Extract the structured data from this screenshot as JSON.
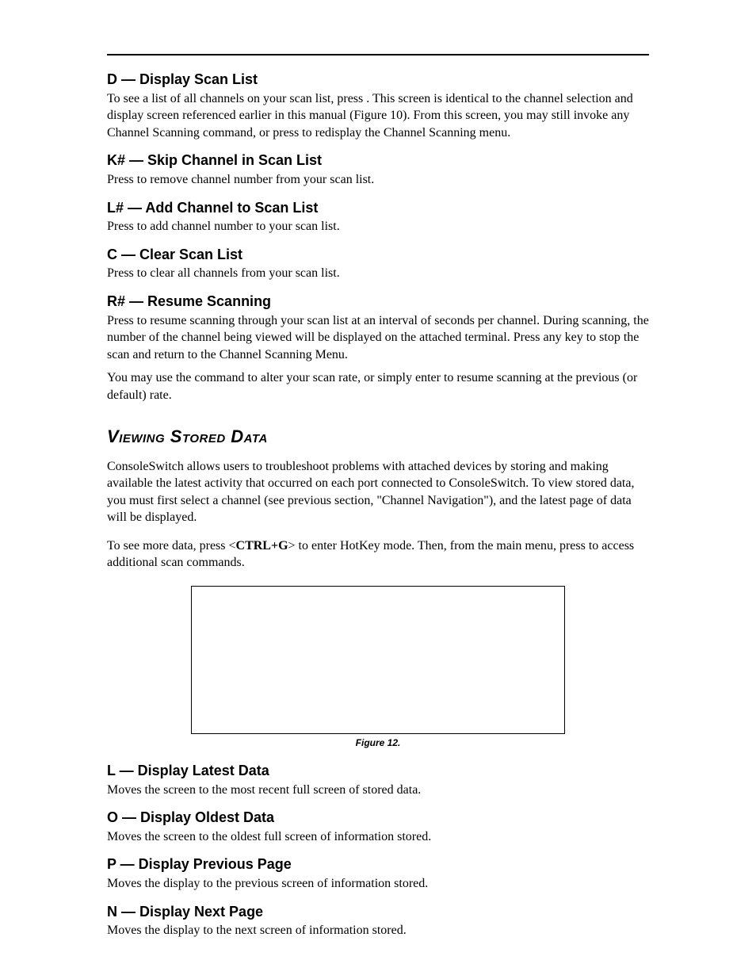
{
  "sections": {
    "d": {
      "heading": "D — Display Scan List",
      "p1": "To see a list of all channels on your scan list, press       . This screen is identical to the channel selection and display screen referenced earlier in this manual (Figure 10). From this screen, you may still invoke any Channel Scanning command, or press        to redisplay the Channel Scanning menu."
    },
    "k": {
      "heading": "K# — Skip Channel in Scan List",
      "p1": "Press         to remove channel number    from your scan list."
    },
    "l_add": {
      "heading": "L# — Add Channel to Scan List",
      "p1": "Press         to add channel number    to your scan list."
    },
    "c": {
      "heading": "C — Clear Scan List",
      "p1": "Press        to clear all channels from your scan list."
    },
    "r": {
      "heading": "R# — Resume Scanning",
      "p1": "Press          to resume scanning through your scan list at an interval of    seconds per channel. During scanning, the number of the channel being viewed will be displayed on the attached terminal. Press any key to stop the scan and return to the Channel Scanning Menu.",
      "p2": "You may use the           command to alter your scan rate, or simply enter        to resume scanning at the previous (or default) rate."
    },
    "viewing": {
      "heading": "Viewing Stored Data",
      "p1": "ConsoleSwitch allows users to troubleshoot problems with attached devices by storing and making available the latest activity that occurred on each port connected to ConsoleSwitch. To view stored data, you must first select a channel (see previous section, \"Channel Navigation\"), and the latest page of data will be displayed.",
      "p2_a": "To see more data, press <",
      "p2_hot": "CTRL+G",
      "p2_b": "> to enter HotKey mode. Then, from the main menu, press        to access additional scan commands.",
      "fig_caption": "Figure 12."
    },
    "l_latest": {
      "heading": "L — Display Latest Data",
      "p1": "Moves the screen to the most recent full screen of stored data."
    },
    "o": {
      "heading": "O — Display Oldest Data",
      "p1": "Moves the screen to the oldest full screen of information stored."
    },
    "p": {
      "heading": "P — Display Previous Page",
      "p1": "Moves the display to the previous screen of information stored."
    },
    "n": {
      "heading": "N — Display Next Page",
      "p1": "Moves the display to the next screen of information stored."
    }
  }
}
